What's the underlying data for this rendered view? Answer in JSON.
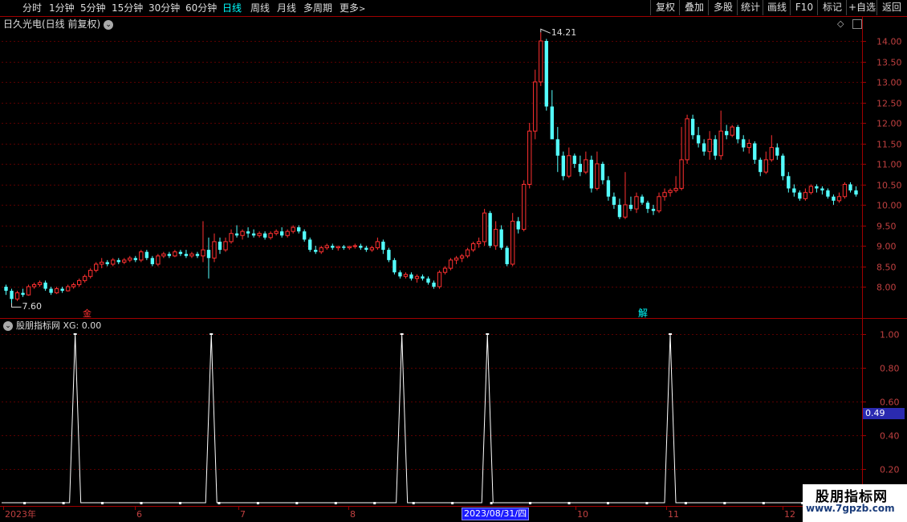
{
  "toolbar": {
    "periods": [
      "分时",
      "1分钟",
      "5分钟",
      "15分钟",
      "30分钟",
      "60分钟",
      "日线",
      "周线",
      "月线",
      "多周期",
      "更多"
    ],
    "active_index": 6,
    "more_arrow": ">",
    "right_buttons": [
      "复权",
      "叠加",
      "多股",
      "统计",
      "画线",
      "F10",
      "标记",
      "+自选",
      "返回"
    ]
  },
  "main_chart": {
    "title": "日久光电(日线 前复权)",
    "dropdown_glyph": "⌄",
    "diamond_glyph": "◇",
    "y_ticks": [
      "14.00",
      "13.50",
      "13.00",
      "12.50",
      "12.00",
      "11.50",
      "11.00",
      "10.50",
      "10.00",
      "9.50",
      "9.00",
      "8.50",
      "8.00"
    ],
    "high_label": "14.21",
    "low_label": "7.60",
    "markers": [
      {
        "text": "金",
        "color": "#ff3030"
      },
      {
        "text": "解",
        "color": "#00ffff"
      }
    ]
  },
  "indicator": {
    "name": "股朋指标网",
    "value_label": "XG: 0.00",
    "y_ticks": [
      "1.00",
      "0.80",
      "0.60",
      "0.40",
      "0.20"
    ],
    "current_value": "0.49"
  },
  "x_axis": {
    "labels": [
      "2023年",
      "6",
      "7",
      "8",
      "9",
      "10",
      "11",
      "12"
    ],
    "selected_date": "2023/08/31/四"
  },
  "watermark": {
    "line1": "股朋指标网",
    "line2": "www.7gpzb.com"
  },
  "colors": {
    "up": "#ff3030",
    "down": "#54ffff",
    "grid": "#5a0000",
    "axis": "#a00000",
    "signal": "#ffffff",
    "active_tab": "#00ffff"
  },
  "chart_data": [
    {
      "type": "candlestick",
      "title": "日久光电(日线 前复权)",
      "ylim": [
        7.6,
        14.21
      ],
      "y_ticks": [
        8.0,
        8.5,
        9.0,
        9.5,
        10.0,
        10.5,
        11.0,
        11.5,
        12.0,
        12.5,
        13.0,
        13.5,
        14.0
      ],
      "x_labels": [
        "2023年",
        "6",
        "7",
        "8",
        "9",
        "10",
        "11",
        "12"
      ],
      "max_value": 14.21,
      "min_value": 7.6,
      "ohlc": [
        [
          8.0,
          8.05,
          7.8,
          7.9
        ],
        [
          7.9,
          7.95,
          7.6,
          7.7
        ],
        [
          7.7,
          7.9,
          7.65,
          7.85
        ],
        [
          7.85,
          7.95,
          7.75,
          7.8
        ],
        [
          7.8,
          8.05,
          7.78,
          8.0
        ],
        [
          8.0,
          8.1,
          7.95,
          8.05
        ],
        [
          8.05,
          8.15,
          8.0,
          8.1
        ],
        [
          8.1,
          8.15,
          7.9,
          7.95
        ],
        [
          7.95,
          8.0,
          7.8,
          7.85
        ],
        [
          7.85,
          8.0,
          7.82,
          7.95
        ],
        [
          7.95,
          8.0,
          7.85,
          7.9
        ],
        [
          7.9,
          8.05,
          7.88,
          8.0
        ],
        [
          8.0,
          8.1,
          7.95,
          8.05
        ],
        [
          8.05,
          8.2,
          8.0,
          8.15
        ],
        [
          8.15,
          8.3,
          8.1,
          8.25
        ],
        [
          8.25,
          8.45,
          8.2,
          8.4
        ],
        [
          8.4,
          8.6,
          8.35,
          8.55
        ],
        [
          8.55,
          8.7,
          8.45,
          8.6
        ],
        [
          8.6,
          8.65,
          8.5,
          8.55
        ],
        [
          8.55,
          8.7,
          8.5,
          8.65
        ],
        [
          8.65,
          8.7,
          8.55,
          8.6
        ],
        [
          8.6,
          8.7,
          8.55,
          8.65
        ],
        [
          8.65,
          8.75,
          8.6,
          8.7
        ],
        [
          8.7,
          8.75,
          8.6,
          8.65
        ],
        [
          8.65,
          8.9,
          8.6,
          8.85
        ],
        [
          8.85,
          8.9,
          8.65,
          8.7
        ],
        [
          8.7,
          8.75,
          8.5,
          8.55
        ],
        [
          8.55,
          8.8,
          8.5,
          8.75
        ],
        [
          8.75,
          8.85,
          8.7,
          8.8
        ],
        [
          8.8,
          8.85,
          8.7,
          8.75
        ],
        [
          8.75,
          8.9,
          8.72,
          8.85
        ],
        [
          8.85,
          8.9,
          8.75,
          8.8
        ],
        [
          8.8,
          8.9,
          8.7,
          8.75
        ],
        [
          8.75,
          8.85,
          8.7,
          8.8
        ],
        [
          8.8,
          8.85,
          8.7,
          8.75
        ],
        [
          8.75,
          9.6,
          8.6,
          8.9
        ],
        [
          8.9,
          9.2,
          8.2,
          8.7
        ],
        [
          8.7,
          9.3,
          8.6,
          9.1
        ],
        [
          9.1,
          9.2,
          8.8,
          8.9
        ],
        [
          8.9,
          9.2,
          8.85,
          9.1
        ],
        [
          9.1,
          9.4,
          9.05,
          9.3
        ],
        [
          9.3,
          9.5,
          9.2,
          9.25
        ],
        [
          9.25,
          9.4,
          9.15,
          9.35
        ],
        [
          9.35,
          9.45,
          9.2,
          9.3
        ],
        [
          9.3,
          9.4,
          9.2,
          9.25
        ],
        [
          9.25,
          9.35,
          9.2,
          9.3
        ],
        [
          9.3,
          9.35,
          9.15,
          9.2
        ],
        [
          9.2,
          9.35,
          9.15,
          9.3
        ],
        [
          9.3,
          9.4,
          9.25,
          9.35
        ],
        [
          9.35,
          9.45,
          9.2,
          9.25
        ],
        [
          9.25,
          9.4,
          9.2,
          9.35
        ],
        [
          9.35,
          9.5,
          9.3,
          9.45
        ],
        [
          9.45,
          9.5,
          9.3,
          9.35
        ],
        [
          9.35,
          9.4,
          9.1,
          9.15
        ],
        [
          9.15,
          9.2,
          8.85,
          8.9
        ],
        [
          8.9,
          9.0,
          8.8,
          8.85
        ],
        [
          8.85,
          9.0,
          8.8,
          8.95
        ],
        [
          8.95,
          9.05,
          8.9,
          9.0
        ],
        [
          9.0,
          9.05,
          8.9,
          8.95
        ],
        [
          8.95,
          9.0,
          8.88,
          8.98
        ],
        [
          8.98,
          9.02,
          8.9,
          8.95
        ],
        [
          8.95,
          9.0,
          8.9,
          8.98
        ],
        [
          8.98,
          9.05,
          8.93,
          9.0
        ],
        [
          9.0,
          9.05,
          8.9,
          8.95
        ],
        [
          8.95,
          9.0,
          8.85,
          8.9
        ],
        [
          8.9,
          9.0,
          8.85,
          8.95
        ],
        [
          8.95,
          9.2,
          8.9,
          9.1
        ],
        [
          9.1,
          9.15,
          8.8,
          8.9
        ],
        [
          8.9,
          8.95,
          8.6,
          8.65
        ],
        [
          8.65,
          8.7,
          8.3,
          8.35
        ],
        [
          8.35,
          8.4,
          8.2,
          8.25
        ],
        [
          8.25,
          8.35,
          8.2,
          8.3
        ],
        [
          8.3,
          8.35,
          8.15,
          8.2
        ],
        [
          8.2,
          8.3,
          8.1,
          8.25
        ],
        [
          8.25,
          8.3,
          8.15,
          8.2
        ],
        [
          8.2,
          8.25,
          8.05,
          8.1
        ],
        [
          8.1,
          8.15,
          7.95,
          8.0
        ],
        [
          8.0,
          8.4,
          7.95,
          8.35
        ],
        [
          8.35,
          8.5,
          8.3,
          8.45
        ],
        [
          8.45,
          8.7,
          8.4,
          8.65
        ],
        [
          8.65,
          8.75,
          8.55,
          8.7
        ],
        [
          8.7,
          8.8,
          8.6,
          8.75
        ],
        [
          8.75,
          8.95,
          8.7,
          8.9
        ],
        [
          8.9,
          9.1,
          8.85,
          9.05
        ],
        [
          9.05,
          9.2,
          8.95,
          9.1
        ],
        [
          9.1,
          9.9,
          9.0,
          9.8
        ],
        [
          9.8,
          9.85,
          8.95,
          9.0
        ],
        [
          9.0,
          9.6,
          8.9,
          9.4
        ],
        [
          9.4,
          9.5,
          8.9,
          8.95
        ],
        [
          8.95,
          9.0,
          8.5,
          8.55
        ],
        [
          8.55,
          9.8,
          8.5,
          9.6
        ],
        [
          9.6,
          9.7,
          9.3,
          9.4
        ],
        [
          9.4,
          10.6,
          9.35,
          10.5
        ],
        [
          10.5,
          12.0,
          10.4,
          11.8
        ],
        [
          11.8,
          13.3,
          11.6,
          13.0
        ],
        [
          13.0,
          14.21,
          12.9,
          14.0
        ],
        [
          14.0,
          14.05,
          12.3,
          12.4
        ],
        [
          12.4,
          12.8,
          11.9,
          11.6
        ],
        [
          11.6,
          11.9,
          10.8,
          11.2
        ],
        [
          11.2,
          11.3,
          10.6,
          10.7
        ],
        [
          10.7,
          11.4,
          10.65,
          11.2
        ],
        [
          11.2,
          11.25,
          10.9,
          11.0
        ],
        [
          11.0,
          11.2,
          10.7,
          10.8
        ],
        [
          10.8,
          11.3,
          10.75,
          11.1
        ],
        [
          11.1,
          11.2,
          10.3,
          10.4
        ],
        [
          10.4,
          11.3,
          10.35,
          11.0
        ],
        [
          11.0,
          11.05,
          10.5,
          10.6
        ],
        [
          10.6,
          10.7,
          10.1,
          10.2
        ],
        [
          10.2,
          10.3,
          9.9,
          10.0
        ],
        [
          10.0,
          10.15,
          9.65,
          9.7
        ],
        [
          9.7,
          10.8,
          9.65,
          10.0
        ],
        [
          10.0,
          10.2,
          9.85,
          9.9
        ],
        [
          9.9,
          10.3,
          9.8,
          10.2
        ],
        [
          10.2,
          10.25,
          10.0,
          10.05
        ],
        [
          10.05,
          10.1,
          9.8,
          9.9
        ],
        [
          9.9,
          10.0,
          9.75,
          9.85
        ],
        [
          9.85,
          10.3,
          9.8,
          10.2
        ],
        [
          10.2,
          10.4,
          10.1,
          10.3
        ],
        [
          10.3,
          10.4,
          10.2,
          10.35
        ],
        [
          10.35,
          10.7,
          10.3,
          10.4
        ],
        [
          10.4,
          11.9,
          10.35,
          11.1
        ],
        [
          11.1,
          12.2,
          11.0,
          12.1
        ],
        [
          12.1,
          12.2,
          11.6,
          11.7
        ],
        [
          11.7,
          11.9,
          11.4,
          11.5
        ],
        [
          11.5,
          11.6,
          11.2,
          11.3
        ],
        [
          11.3,
          11.8,
          11.1,
          11.6
        ],
        [
          11.6,
          11.7,
          11.1,
          11.2
        ],
        [
          11.2,
          12.3,
          11.1,
          11.8
        ],
        [
          11.8,
          11.95,
          11.6,
          11.7
        ],
        [
          11.7,
          11.95,
          11.65,
          11.9
        ],
        [
          11.9,
          11.95,
          11.5,
          11.6
        ],
        [
          11.6,
          11.7,
          11.3,
          11.4
        ],
        [
          11.4,
          11.6,
          11.25,
          11.5
        ],
        [
          11.5,
          11.55,
          11.0,
          11.1
        ],
        [
          11.1,
          11.15,
          10.7,
          10.8
        ],
        [
          10.8,
          11.3,
          10.75,
          11.1
        ],
        [
          11.1,
          11.7,
          11.05,
          11.4
        ],
        [
          11.4,
          11.5,
          11.1,
          11.2
        ],
        [
          11.2,
          11.25,
          10.6,
          10.7
        ],
        [
          10.7,
          10.8,
          10.3,
          10.4
        ],
        [
          10.4,
          10.5,
          10.2,
          10.3
        ],
        [
          10.3,
          10.35,
          10.1,
          10.15
        ],
        [
          10.15,
          10.4,
          10.1,
          10.3
        ],
        [
          10.3,
          10.5,
          10.25,
          10.45
        ],
        [
          10.45,
          10.5,
          10.3,
          10.4
        ],
        [
          10.4,
          10.45,
          10.25,
          10.35
        ],
        [
          10.35,
          10.4,
          10.15,
          10.2
        ],
        [
          10.2,
          10.25,
          10.0,
          10.1
        ],
        [
          10.1,
          10.3,
          10.05,
          10.2
        ],
        [
          10.2,
          10.55,
          10.15,
          10.5
        ],
        [
          10.5,
          10.55,
          10.3,
          10.35
        ],
        [
          10.35,
          10.45,
          10.2,
          10.25
        ]
      ]
    },
    {
      "type": "line",
      "title": "股朋指标网",
      "series": [
        {
          "name": "XG",
          "x": [
            18,
            53,
            102,
            124,
            171
          ],
          "values": [
            1,
            1,
            1,
            1,
            1
          ]
        }
      ],
      "ylim": [
        0,
        1.05
      ],
      "y_ticks": [
        0.2,
        0.4,
        0.6,
        0.8,
        1.0
      ],
      "baseline": 0,
      "total_points": 220,
      "current": 0.49
    }
  ]
}
